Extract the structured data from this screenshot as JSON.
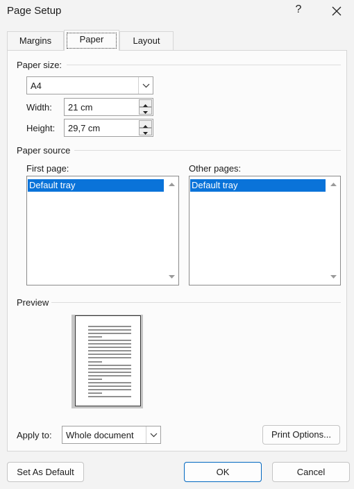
{
  "window": {
    "title": "Page Setup",
    "help": "?"
  },
  "tabs": [
    {
      "label": "Margins"
    },
    {
      "label": "Paper"
    },
    {
      "label": "Layout"
    }
  ],
  "paper_size": {
    "label": "Paper size:",
    "selected": "A4",
    "width_label": "Width:",
    "width_value": "21 cm",
    "height_label": "Height:",
    "height_value": "29,7 cm"
  },
  "paper_source": {
    "label": "Paper source",
    "first_page": {
      "label": "First page:",
      "items": [
        "Default tray"
      ]
    },
    "other_pages": {
      "label": "Other pages:",
      "items": [
        "Default tray"
      ]
    }
  },
  "preview": {
    "label": "Preview"
  },
  "apply_to": {
    "label": "Apply to:",
    "selected": "Whole document"
  },
  "buttons": {
    "print_options": "Print Options...",
    "set_as_default": "Set As Default",
    "ok": "OK",
    "cancel": "Cancel"
  },
  "colors": {
    "selection": "#0a73d9",
    "ok_border": "#0067c0"
  },
  "icons": [
    "close-icon",
    "chevron-down-icon",
    "spin-up-icon",
    "spin-down-icon",
    "scroll-up-icon",
    "scroll-down-icon"
  ]
}
